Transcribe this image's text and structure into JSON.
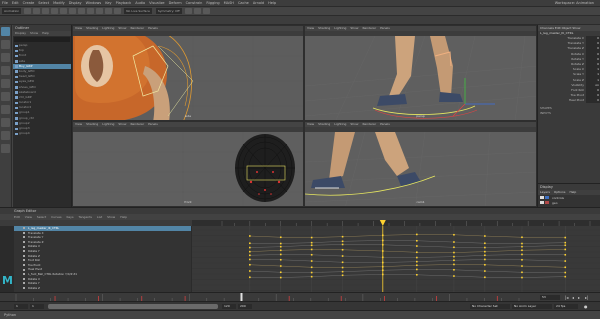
{
  "app": {
    "name": "Maya",
    "logo": "M"
  },
  "menubar": {
    "items": [
      "File",
      "Edit",
      "Create",
      "Select",
      "Modify",
      "Display",
      "Windows",
      "Key",
      "Playback",
      "Audio",
      "Visualize",
      "Deform",
      "Constrain",
      "Rigging",
      "MASH",
      "Cache",
      "Arnold",
      "Help"
    ],
    "right_label": "Workspace: Animation"
  },
  "status_line": {
    "mode": "Animation",
    "search_placeholder": "No Live Surface",
    "symmetry": "Symmetry: Off"
  },
  "outliner": {
    "title": "Outliner",
    "menu": [
      "Display",
      "Show",
      "Help"
    ],
    "items": [
      "persp",
      "top",
      "front",
      "side",
      "Boy_GRP",
      "body_GEO",
      "head_GEO",
      "eyes_GEO",
      "shoes_GEO",
      "skateboard",
      "ctrl_GRP",
      "locator1",
      "locator2",
      "group1",
      "group_ctrl",
      "group2",
      "group3",
      "group4"
    ],
    "selected_index": 4
  },
  "viewports": [
    {
      "id": "vp1",
      "menu": [
        "View",
        "Shading",
        "Lighting",
        "Show",
        "Renderer",
        "Panels"
      ],
      "camera": "side"
    },
    {
      "id": "vp2",
      "menu": [
        "View",
        "Shading",
        "Lighting",
        "Show",
        "Renderer",
        "Panels"
      ],
      "camera": "persp"
    },
    {
      "id": "vp3",
      "menu": [
        "View",
        "Shading",
        "Lighting",
        "Show",
        "Renderer",
        "Panels"
      ],
      "camera": "front"
    },
    {
      "id": "vp4",
      "menu": [
        "View",
        "Shading",
        "Lighting",
        "Show",
        "Renderer",
        "Panels"
      ],
      "camera": "cam1"
    }
  ],
  "channel_box": {
    "tabs": "Channels  Edit  Object  Show",
    "object_name": "L_leg_master_IK_CTRL",
    "attributes": [
      {
        "label": "Translate X",
        "value": "0"
      },
      {
        "label": "Translate Y",
        "value": "0"
      },
      {
        "label": "Translate Z",
        "value": "0"
      },
      {
        "label": "Rotate X",
        "value": "0"
      },
      {
        "label": "Rotate Y",
        "value": "0"
      },
      {
        "label": "Rotate Z",
        "value": "0"
      },
      {
        "label": "Scale X",
        "value": "1"
      },
      {
        "label": "Scale Y",
        "value": "1"
      },
      {
        "label": "Scale Z",
        "value": "1"
      },
      {
        "label": "Visibility",
        "value": "on"
      },
      {
        "label": "Foot Roll",
        "value": "0"
      },
      {
        "label": "Toe Pivot",
        "value": "0"
      },
      {
        "label": "Heel Pivot",
        "value": "0"
      }
    ],
    "shapes_label": "SHAPES",
    "inputs_label": "INPUTS",
    "layers_title": "Display",
    "layer_tabs": [
      "Layers",
      "Options",
      "Help"
    ],
    "layers": [
      {
        "name": "controls"
      },
      {
        "name": "geo"
      }
    ]
  },
  "graph_editor": {
    "title": "Graph Editor",
    "menu": [
      "Edit",
      "View",
      "Select",
      "Curves",
      "Keys",
      "Tangents",
      "List",
      "Show",
      "Help"
    ],
    "selected_node": "L_leg_master_IK_CTRL",
    "channels": [
      "L_leg_master_IK_CTRL",
      "Translate X",
      "Translate Y",
      "Translate Z",
      "Rotate X",
      "Rotate Y",
      "Rotate Z",
      "Foot Roll",
      "Toe Pivot",
      "Heel Pivot",
      "L_foot_Ball_CTRL Rotation Y/X/Z Z1",
      "Rotate X",
      "Rotate Y",
      "Rotate Z"
    ],
    "current_frame": 53,
    "key_frames": [
      10,
      20,
      30,
      40,
      53,
      64,
      76,
      86,
      98,
      112
    ],
    "colors": {
      "current_time": "#ffd230",
      "selected": "#5285a6",
      "curve": "#b89a5a"
    }
  },
  "time_slider": {
    "start": 1,
    "end": 120,
    "current": 53
  },
  "range_slider": {
    "start_field": "1",
    "min_field": "1",
    "max_field": "120",
    "end_field": "200",
    "char_set": "No Character Set",
    "anim_layer": "No Anim Layer",
    "fps": "24 fps"
  },
  "help_line": "Python"
}
